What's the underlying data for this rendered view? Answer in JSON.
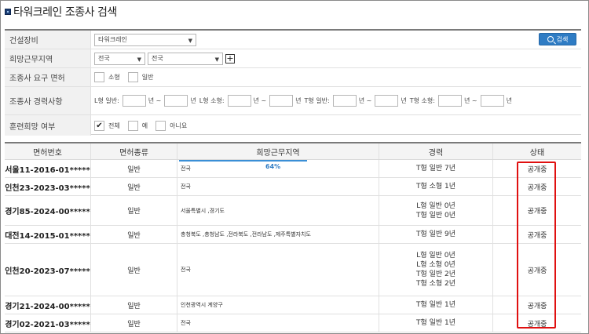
{
  "page_title": "타워크레인 조종사 검색",
  "form": {
    "equipment": {
      "label": "건설장비",
      "value": "타워크레인"
    },
    "region": {
      "label": "희망근무지역",
      "value1": "전국",
      "value2": "전국"
    },
    "license": {
      "label": "조종사 요구 면허",
      "opt1": "소형",
      "opt2": "일반"
    },
    "experience": {
      "label": "조종사 경력사항",
      "l_general": "L형 일반:",
      "l_small": "L형 소형:",
      "t_general": "T형 일반:",
      "t_small": "T형 소형:",
      "unit_range": "년 ~",
      "unit_year": "년"
    },
    "training": {
      "label": "훈련희망 여부",
      "opt1": "전체",
      "opt2": "예",
      "opt3": "아니요",
      "selected": "전체"
    },
    "search_button": "검색"
  },
  "table": {
    "headers": [
      "면허번호",
      "면허종류",
      "희망근무지역",
      "경력",
      "상태"
    ],
    "progress_percent": "64%",
    "progress_fraction": 0.64,
    "rows": [
      {
        "license_no": "서울11-2016-01*****",
        "type": "일반",
        "region": "전국",
        "experience": [
          "T형 일반 7년"
        ],
        "status": "공개중"
      },
      {
        "license_no": "인천23-2023-03*****",
        "type": "일반",
        "region": "전국",
        "experience": [
          "T형 소형 1년"
        ],
        "status": "공개중"
      },
      {
        "license_no": "경기85-2024-00*****",
        "type": "일반",
        "region": "서울특별시 ,경기도",
        "experience": [
          "L형 일반 0년",
          "T형 일반 0년"
        ],
        "status": "공개중"
      },
      {
        "license_no": "대전14-2015-01*****",
        "type": "일반",
        "region": "충청북도 ,충청남도 ,전라북도 ,전라남도 ,제주특별자치도",
        "experience": [
          "T형 일반 9년"
        ],
        "status": "공개중"
      },
      {
        "license_no": "인천20-2023-07*****",
        "type": "일반",
        "region": "전국",
        "experience": [
          "L형 일반 0년",
          "L형 소형 0년",
          "T형 일반 2년",
          "T형 소형 2년"
        ],
        "status": "공개중"
      },
      {
        "license_no": "경기21-2024-00*****",
        "type": "일반",
        "region": "인천광역시 계양구",
        "experience": [
          "T형 일반 1년"
        ],
        "status": "공개중"
      },
      {
        "license_no": "경기02-2021-03*****",
        "type": "일반",
        "region": "전국",
        "experience": [
          "T형 일반 1년"
        ],
        "status": "공개중"
      }
    ]
  },
  "colors": {
    "accent": "#2f7cc4",
    "highlight": "#e01010"
  }
}
